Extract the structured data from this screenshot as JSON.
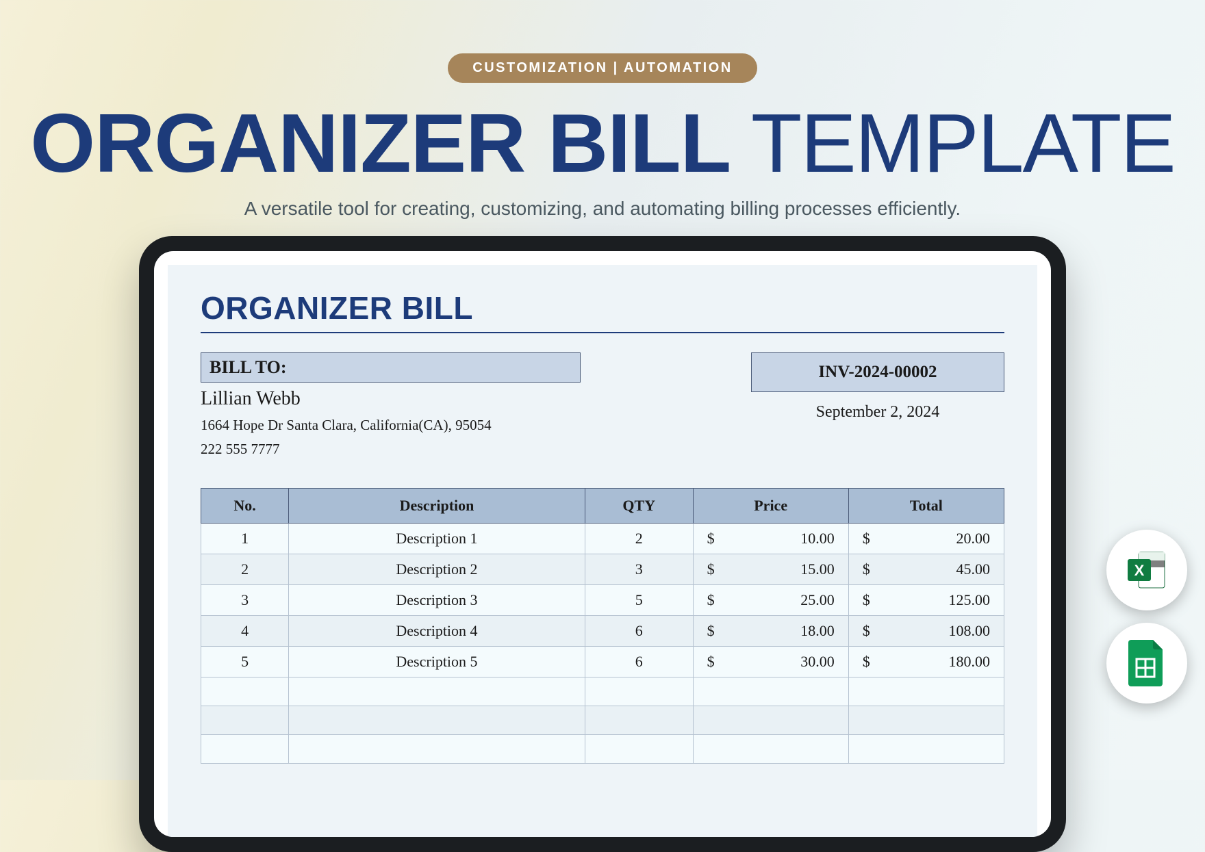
{
  "header": {
    "pill": "CUSTOMIZATION  |  AUTOMATION",
    "title_bold": "ORGANIZER BILL",
    "title_light": " TEMPLATE",
    "subtitle": "A versatile tool for creating, customizing, and automating billing processes efficiently."
  },
  "document": {
    "title": "ORGANIZER BILL",
    "bill_to_label": "BILL TO:",
    "customer": {
      "name": "Lillian Webb",
      "address": "1664 Hope Dr Santa Clara, California(CA), 95054",
      "phone": "222 555 7777"
    },
    "invoice_number": "INV-2024-00002",
    "invoice_date": "September 2, 2024",
    "columns": {
      "no": "No.",
      "description": "Description",
      "qty": "QTY",
      "price": "Price",
      "total": "Total"
    },
    "rows": [
      {
        "no": "1",
        "description": "Description 1",
        "qty": "2",
        "price": "10.00",
        "total": "20.00"
      },
      {
        "no": "2",
        "description": "Description 2",
        "qty": "3",
        "price": "15.00",
        "total": "45.00"
      },
      {
        "no": "3",
        "description": "Description 3",
        "qty": "5",
        "price": "25.00",
        "total": "125.00"
      },
      {
        "no": "4",
        "description": "Description 4",
        "qty": "6",
        "price": "18.00",
        "total": "108.00"
      },
      {
        "no": "5",
        "description": "Description 5",
        "qty": "6",
        "price": "30.00",
        "total": "180.00"
      }
    ],
    "currency_symbol": "$"
  },
  "icons": {
    "excel": "excel-icon",
    "sheets": "sheets-icon"
  }
}
